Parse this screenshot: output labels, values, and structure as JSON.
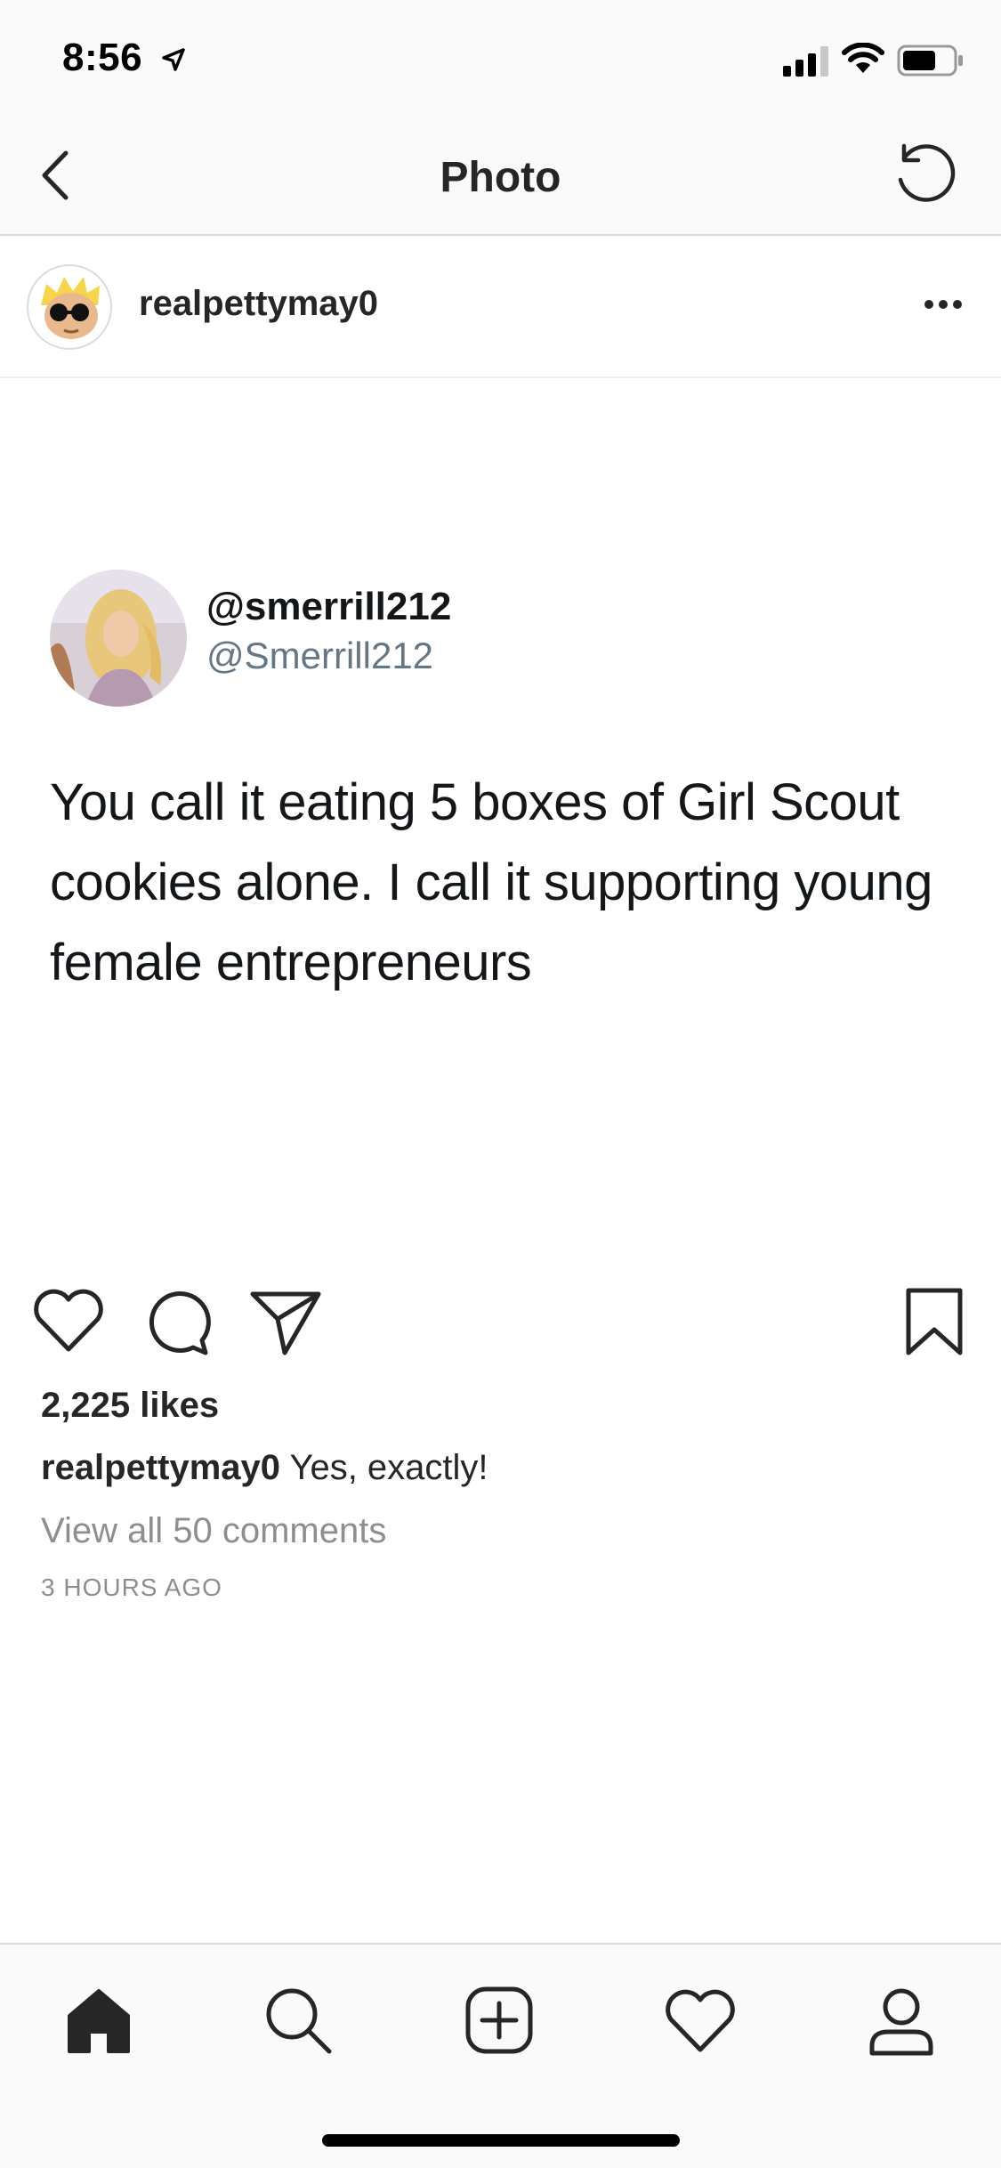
{
  "status_bar": {
    "time": "8:56"
  },
  "nav": {
    "title": "Photo"
  },
  "post": {
    "username": "realpettymay0",
    "tweet": {
      "name": "@smerrill212",
      "handle": "@Smerrill212",
      "text": "You call it eating 5 boxes of Girl Scout cookies alone. I call it supporting young female entrepreneurs"
    },
    "likes": "2,225 likes",
    "caption_user": "realpettymay0",
    "caption_text": "Yes, exactly!",
    "view_comments": "View all 50 comments",
    "time_ago": "3 HOURS AGO"
  },
  "icons": {
    "back": "chevron-left-icon",
    "refresh": "refresh-icon",
    "more": "more-horizontal-icon",
    "like": "heart-icon",
    "comment": "comment-icon",
    "share": "paper-plane-icon",
    "save": "bookmark-icon",
    "tabs": [
      "home-icon",
      "search-icon",
      "add-icon",
      "activity-heart-icon",
      "profile-icon"
    ]
  }
}
